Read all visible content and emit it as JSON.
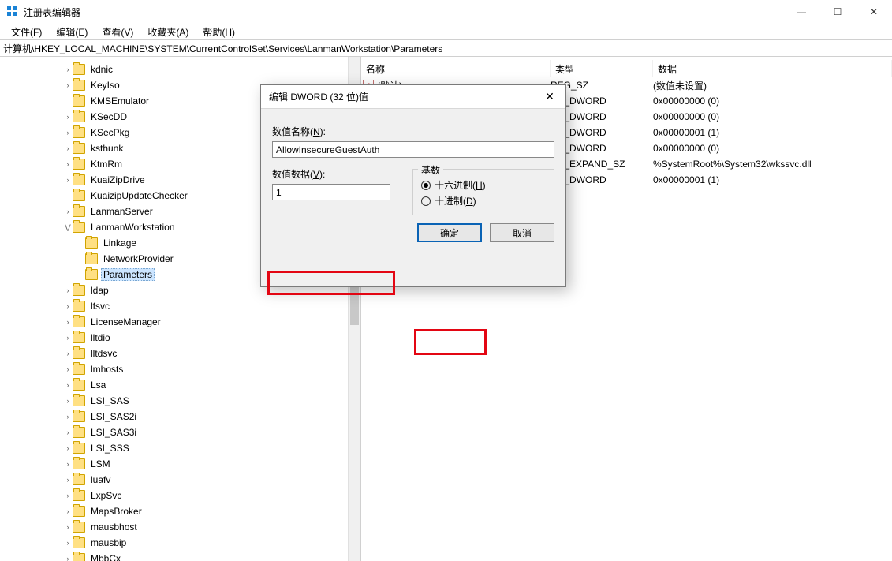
{
  "window": {
    "title": "注册表编辑器",
    "controls": {
      "min": "—",
      "max": "☐",
      "close": "✕"
    }
  },
  "menubar": [
    "文件(F)",
    "编辑(E)",
    "查看(V)",
    "收藏夹(A)",
    "帮助(H)"
  ],
  "addressbar": "计算机\\HKEY_LOCAL_MACHINE\\SYSTEM\\CurrentControlSet\\Services\\LanmanWorkstation\\Parameters",
  "tree": [
    {
      "indent": 5,
      "exp": "›",
      "name": "kdnic"
    },
    {
      "indent": 5,
      "exp": "›",
      "name": "KeyIso"
    },
    {
      "indent": 5,
      "exp": "",
      "name": "KMSEmulator"
    },
    {
      "indent": 5,
      "exp": "›",
      "name": "KSecDD"
    },
    {
      "indent": 5,
      "exp": "›",
      "name": "KSecPkg"
    },
    {
      "indent": 5,
      "exp": "›",
      "name": "ksthunk"
    },
    {
      "indent": 5,
      "exp": "›",
      "name": "KtmRm"
    },
    {
      "indent": 5,
      "exp": "›",
      "name": "KuaiZipDrive"
    },
    {
      "indent": 5,
      "exp": "",
      "name": "KuaizipUpdateChecker"
    },
    {
      "indent": 5,
      "exp": "›",
      "name": "LanmanServer"
    },
    {
      "indent": 5,
      "exp": "⋁",
      "name": "LanmanWorkstation",
      "expanded": true
    },
    {
      "indent": 6,
      "exp": "",
      "name": "Linkage"
    },
    {
      "indent": 6,
      "exp": "",
      "name": "NetworkProvider"
    },
    {
      "indent": 6,
      "exp": "",
      "name": "Parameters",
      "selected": true
    },
    {
      "indent": 5,
      "exp": "›",
      "name": "ldap"
    },
    {
      "indent": 5,
      "exp": "›",
      "name": "lfsvc"
    },
    {
      "indent": 5,
      "exp": "›",
      "name": "LicenseManager"
    },
    {
      "indent": 5,
      "exp": "›",
      "name": "lltdio"
    },
    {
      "indent": 5,
      "exp": "›",
      "name": "lltdsvc"
    },
    {
      "indent": 5,
      "exp": "›",
      "name": "lmhosts"
    },
    {
      "indent": 5,
      "exp": "›",
      "name": "Lsa"
    },
    {
      "indent": 5,
      "exp": "›",
      "name": "LSI_SAS"
    },
    {
      "indent": 5,
      "exp": "›",
      "name": "LSI_SAS2i"
    },
    {
      "indent": 5,
      "exp": "›",
      "name": "LSI_SAS3i"
    },
    {
      "indent": 5,
      "exp": "›",
      "name": "LSI_SSS"
    },
    {
      "indent": 5,
      "exp": "›",
      "name": "LSM"
    },
    {
      "indent": 5,
      "exp": "›",
      "name": "luafv"
    },
    {
      "indent": 5,
      "exp": "›",
      "name": "LxpSvc"
    },
    {
      "indent": 5,
      "exp": "›",
      "name": "MapsBroker"
    },
    {
      "indent": 5,
      "exp": "›",
      "name": "mausbhost"
    },
    {
      "indent": 5,
      "exp": "›",
      "name": "mausbip"
    },
    {
      "indent": 5,
      "exp": "›",
      "name": "MbbCx"
    }
  ],
  "list": {
    "columns": {
      "name": "名称",
      "type": "类型",
      "data": "数据"
    },
    "rows": [
      {
        "icon": "str",
        "name": "(默认)",
        "type": "REG_SZ",
        "data": "(数值未设置)"
      },
      {
        "icon": "num",
        "name": "",
        "type": "EG_DWORD",
        "data": "0x00000000 (0)"
      },
      {
        "icon": "num",
        "name": "",
        "type": "EG_DWORD",
        "data": "0x00000000 (0)"
      },
      {
        "icon": "num",
        "name": "",
        "type": "EG_DWORD",
        "data": "0x00000001 (1)"
      },
      {
        "icon": "num",
        "name": "",
        "type": "EG_DWORD",
        "data": "0x00000000 (0)"
      },
      {
        "icon": "str",
        "name": "",
        "type": "EG_EXPAND_SZ",
        "data": "%SystemRoot%\\System32\\wkssvc.dll"
      },
      {
        "icon": "num",
        "name": "",
        "type": "EG_DWORD",
        "data": "0x00000001 (1)"
      }
    ]
  },
  "dialog": {
    "title": "编辑 DWORD (32 位)值",
    "name_label": "数值名称(",
    "name_label_u": "N",
    "name_label_end": "):",
    "name_value": "AllowInsecureGuestAuth",
    "data_label": "数值数据(",
    "data_label_u": "V",
    "data_label_end": "):",
    "data_value": "1",
    "base_legend": "基数",
    "radio_hex": "十六进制(",
    "radio_hex_u": "H",
    "radio_hex_end": ")",
    "radio_dec": "十进制(",
    "radio_dec_u": "D",
    "radio_dec_end": ")",
    "ok": "确定",
    "cancel": "取消"
  }
}
